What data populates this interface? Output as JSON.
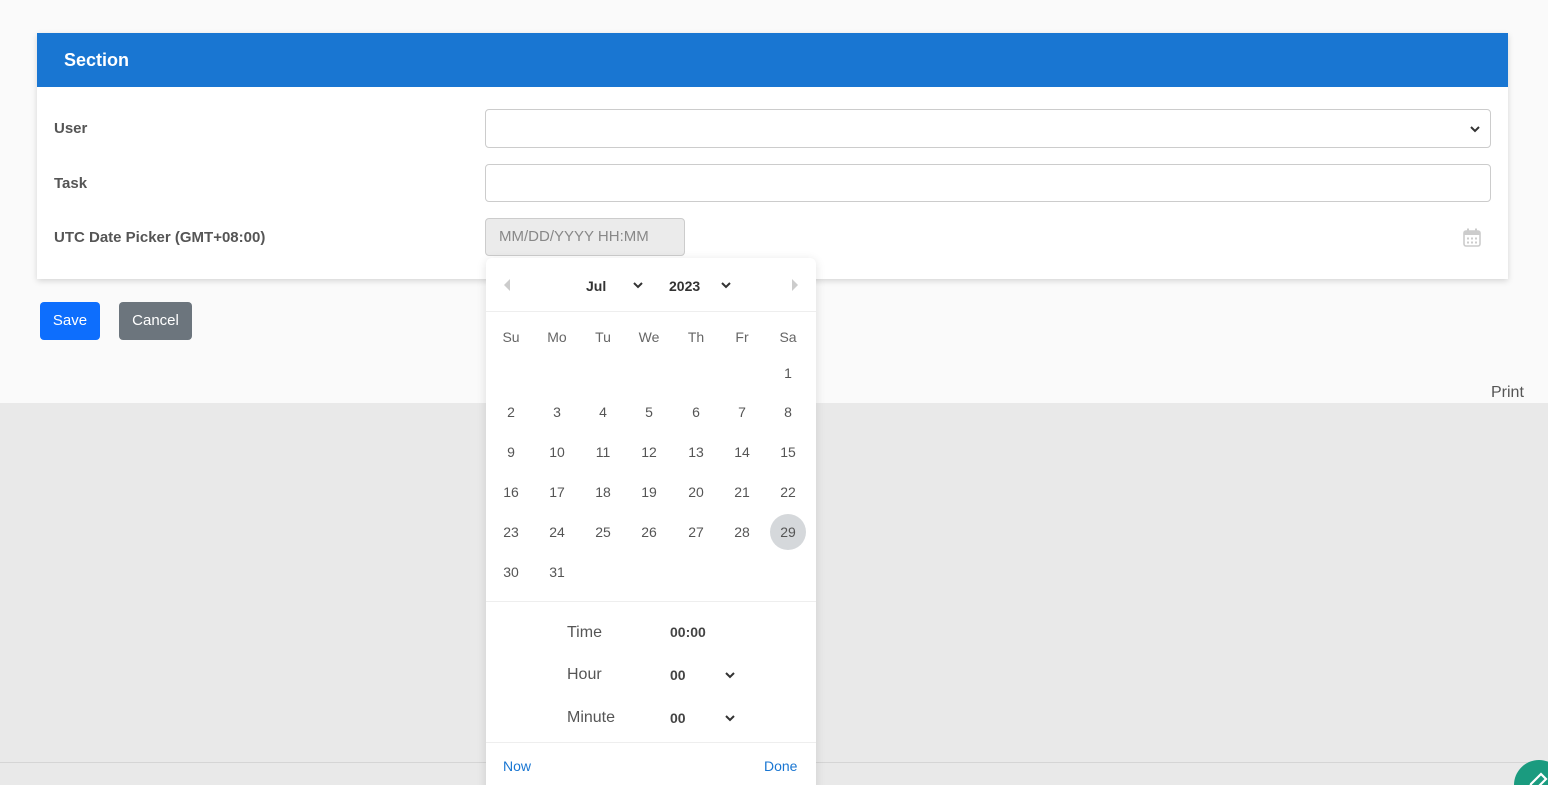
{
  "section": {
    "title": "Section",
    "fields": {
      "user_label": "User",
      "user_value": "",
      "task_label": "Task",
      "task_value": "",
      "date_label": "UTC Date Picker (GMT+08:00)",
      "date_placeholder": "MM/DD/YYYY HH:MM"
    }
  },
  "actions": {
    "save_label": "Save",
    "cancel_label": "Cancel",
    "print_label": "Print"
  },
  "picker": {
    "month": "Jul",
    "year": "2023",
    "weekdays": [
      "Su",
      "Mo",
      "Tu",
      "We",
      "Th",
      "Fr",
      "Sa"
    ],
    "weeks": [
      [
        "",
        "",
        "",
        "",
        "",
        "",
        "1"
      ],
      [
        "2",
        "3",
        "4",
        "5",
        "6",
        "7",
        "8"
      ],
      [
        "9",
        "10",
        "11",
        "12",
        "13",
        "14",
        "15"
      ],
      [
        "16",
        "17",
        "18",
        "19",
        "20",
        "21",
        "22"
      ],
      [
        "23",
        "24",
        "25",
        "26",
        "27",
        "28",
        "29"
      ],
      [
        "30",
        "31",
        "",
        "",
        "",
        "",
        ""
      ]
    ],
    "selected_day": "29",
    "time_label": "Time",
    "time_value": "00:00",
    "hour_label": "Hour",
    "hour_value": "00",
    "minute_label": "Minute",
    "minute_value": "00",
    "now_label": "Now",
    "done_label": "Done"
  },
  "colors": {
    "header": "#1976d2",
    "save": "#0d6efd",
    "cancel": "#6c757d",
    "link": "#1976d2",
    "fab": "#1a9b7f"
  },
  "icons": {
    "calendar": "calendar-icon",
    "select_chevron": "chevron-down-icon",
    "prev": "prev-month-icon",
    "next": "next-month-icon",
    "fab": "pencil-icon"
  }
}
